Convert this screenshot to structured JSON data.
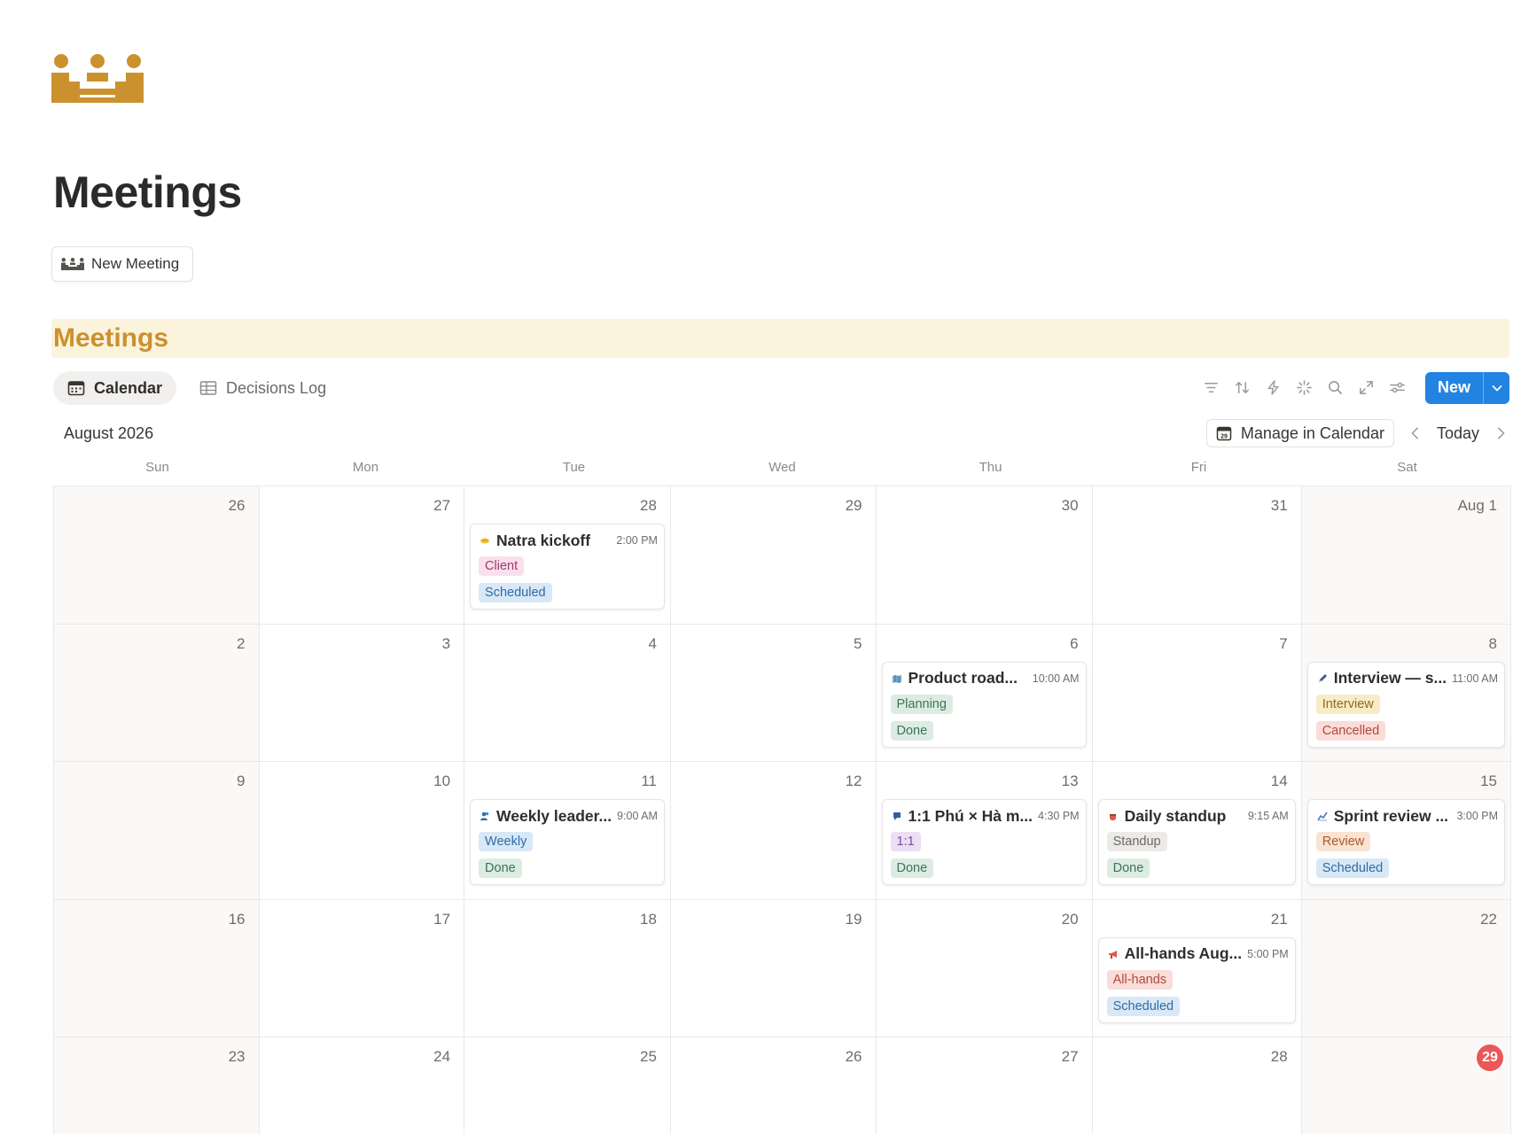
{
  "page": {
    "title": "Meetings",
    "new_meeting_label": "New Meeting",
    "icon": "meeting-people-icon",
    "accent": "#cb912f"
  },
  "section": {
    "title": "Meetings",
    "background": "#fbf3db",
    "views": [
      {
        "label": "Calendar",
        "icon": "calendar-icon",
        "active": true
      },
      {
        "label": "Decisions Log",
        "icon": "table-icon",
        "active": false
      }
    ],
    "toolbar": {
      "icons": [
        "filter-icon",
        "sort-icon",
        "automation-icon",
        "ai-sparkle-icon",
        "search-icon",
        "expand-icon",
        "settings-icon"
      ],
      "new_label": "New",
      "new_color": "#2383e2"
    }
  },
  "calendar": {
    "month_label": "August 2026",
    "manage_label": "Manage in Calendar",
    "today_label": "Today",
    "weekdays": [
      "Sun",
      "Mon",
      "Tue",
      "Wed",
      "Thu",
      "Fri",
      "Sat"
    ],
    "today_day": "29",
    "today_color": "#eb5757",
    "days": [
      "26",
      "27",
      "28",
      "29",
      "30",
      "31",
      "Aug 1",
      "2",
      "3",
      "4",
      "5",
      "6",
      "7",
      "8",
      "9",
      "10",
      "11",
      "12",
      "13",
      "14",
      "15",
      "16",
      "17",
      "18",
      "19",
      "20",
      "21",
      "22",
      "23",
      "24",
      "25",
      "26",
      "27",
      "28",
      "29"
    ],
    "events": [
      {
        "cell": 2,
        "emoji": "handshake-icon",
        "title": "Natra kickoff",
        "time": "2:00 PM",
        "tags": [
          {
            "label": "Client",
            "bg": "#f9e0ec",
            "fg": "#9d3b6b"
          },
          {
            "label": "Scheduled",
            "bg": "#d8e8f7",
            "fg": "#2f6ba3"
          }
        ]
      },
      {
        "cell": 11,
        "emoji": "map-icon",
        "title": "Product road...",
        "time": "10:00 AM",
        "tags": [
          {
            "label": "Planning",
            "bg": "#dcece3",
            "fg": "#3c7355"
          },
          {
            "label": "Done",
            "bg": "#dcece3",
            "fg": "#3c7355"
          }
        ]
      },
      {
        "cell": 13,
        "emoji": "pen-icon",
        "title": "Interview — s...",
        "time": "11:00 AM",
        "tags": [
          {
            "label": "Interview",
            "bg": "#f8ecc7",
            "fg": "#8a6a1e"
          },
          {
            "label": "Cancelled",
            "bg": "#fadcd9",
            "fg": "#b04a3e"
          }
        ]
      },
      {
        "cell": 16,
        "emoji": "people-icon",
        "title": "Weekly leader...",
        "time": "9:00 AM",
        "tags": [
          {
            "label": "Weekly",
            "bg": "#d8e8f7",
            "fg": "#2f6ba3"
          },
          {
            "label": "Done",
            "bg": "#dcece3",
            "fg": "#3c7355"
          }
        ]
      },
      {
        "cell": 18,
        "emoji": "chat-icon",
        "title": "1:1 Phú × Hà m...",
        "time": "4:30 PM",
        "tags": [
          {
            "label": "1:1",
            "bg": "#ebdff5",
            "fg": "#7a4a9c"
          },
          {
            "label": "Done",
            "bg": "#dcece3",
            "fg": "#3c7355"
          }
        ]
      },
      {
        "cell": 19,
        "emoji": "coffee-icon",
        "title": "Daily standup",
        "time": "9:15 AM",
        "tags": [
          {
            "label": "Standup",
            "bg": "#ebeae8",
            "fg": "#6b6a66"
          },
          {
            "label": "Done",
            "bg": "#dcece3",
            "fg": "#3c7355"
          }
        ]
      },
      {
        "cell": 20,
        "emoji": "chart-icon",
        "title": "Sprint review ...",
        "time": "3:00 PM",
        "tags": [
          {
            "label": "Review",
            "bg": "#fae3d3",
            "fg": "#a85a2a"
          },
          {
            "label": "Scheduled",
            "bg": "#d8e8f7",
            "fg": "#2f6ba3"
          }
        ]
      },
      {
        "cell": 26,
        "emoji": "megaphone-icon",
        "title": "All-hands Aug...",
        "time": "5:00 PM",
        "tags": [
          {
            "label": "All-hands",
            "bg": "#fadcd9",
            "fg": "#b04a3e"
          },
          {
            "label": "Scheduled",
            "bg": "#d8e8f7",
            "fg": "#2f6ba3"
          }
        ]
      }
    ]
  }
}
